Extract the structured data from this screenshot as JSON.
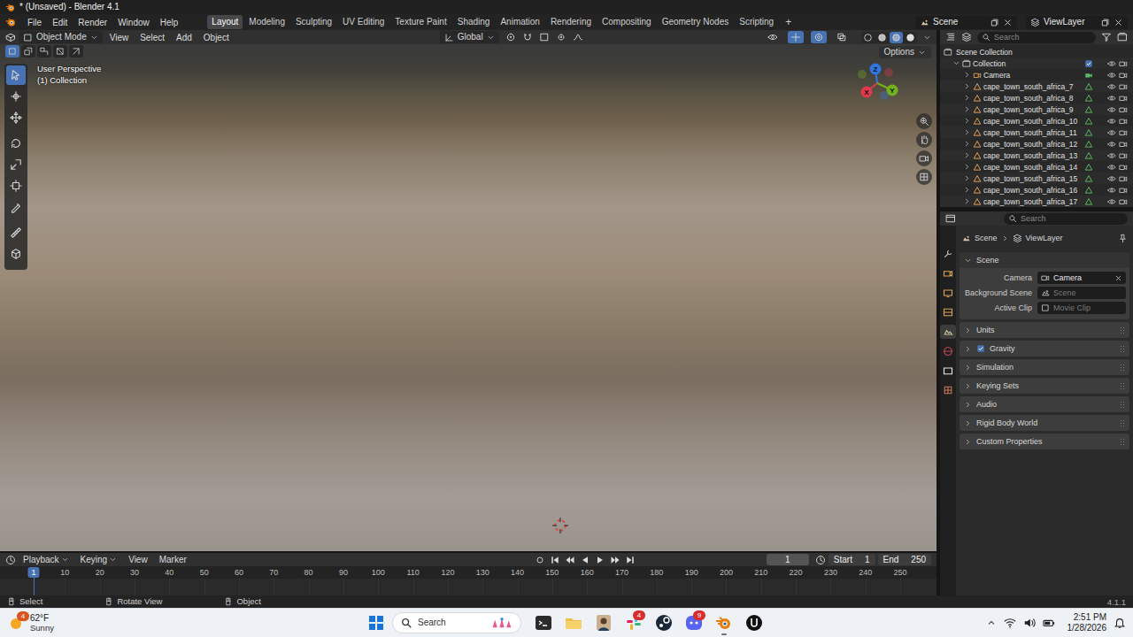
{
  "window": {
    "title": "* (Unsaved) - Blender 4.1"
  },
  "menubar": {
    "menus": [
      "File",
      "Edit",
      "Render",
      "Window",
      "Help"
    ],
    "workspaces": [
      {
        "label": "Layout",
        "selected": true
      },
      {
        "label": "Modeling",
        "selected": false
      },
      {
        "label": "Sculpting",
        "selected": false
      },
      {
        "label": "UV Editing",
        "selected": false
      },
      {
        "label": "Texture Paint",
        "selected": false
      },
      {
        "label": "Shading",
        "selected": false
      },
      {
        "label": "Animation",
        "selected": false
      },
      {
        "label": "Rendering",
        "selected": false
      },
      {
        "label": "Compositing",
        "selected": false
      },
      {
        "label": "Geometry Nodes",
        "selected": false
      },
      {
        "label": "Scripting",
        "selected": false
      }
    ],
    "add_workspace": "+",
    "scene": "Scene",
    "view_layer": "ViewLayer"
  },
  "viewport": {
    "mode": "Object Mode",
    "menus": [
      "View",
      "Select",
      "Add",
      "Object"
    ],
    "orientation": "Global",
    "options": "Options",
    "view_name": "User Perspective",
    "collection": "(1) Collection",
    "select_modes": [
      {
        "selected": true
      },
      {
        "selected": false
      },
      {
        "selected": false
      },
      {
        "selected": false
      },
      {
        "selected": false
      }
    ],
    "tools": [
      {
        "selected": true
      },
      {
        "selected": false
      },
      {
        "selected": false
      },
      {
        "selected": false
      },
      {
        "selected": false
      },
      {
        "selected": false
      },
      {
        "selected": false
      },
      {
        "selected": false
      },
      {
        "selected": false
      }
    ],
    "header_toggles": [
      {
        "selected": false
      },
      {
        "selected": true
      },
      {
        "selected": true
      },
      {
        "selected": false
      }
    ],
    "shading": [
      {
        "selected": false
      },
      {
        "selected": false
      },
      {
        "selected": true
      },
      {
        "selected": false
      }
    ],
    "gizmo": [
      {
        "label": "Z",
        "color": "#2f76e0"
      },
      {
        "label": "X",
        "color": "#e2384d"
      },
      {
        "label": "Y",
        "color": "#72b01e"
      }
    ]
  },
  "outliner": {
    "search": "Search",
    "root": "Scene Collection",
    "items": [
      {
        "label": "Collection",
        "kind": "collection",
        "checked": true,
        "visible": true
      },
      {
        "label": "Camera",
        "kind": "camera",
        "visible": true
      },
      {
        "label": "cape_town_south_africa_7",
        "kind": "mesh",
        "visible": true
      },
      {
        "label": "cape_town_south_africa_8",
        "kind": "mesh",
        "visible": true
      },
      {
        "label": "cape_town_south_africa_9",
        "kind": "mesh",
        "visible": true
      },
      {
        "label": "cape_town_south_africa_10",
        "kind": "mesh",
        "visible": true
      },
      {
        "label": "cape_town_south_africa_11",
        "kind": "mesh",
        "visible": true
      },
      {
        "label": "cape_town_south_africa_12",
        "kind": "mesh",
        "visible": true
      },
      {
        "label": "cape_town_south_africa_13",
        "kind": "mesh",
        "visible": true
      },
      {
        "label": "cape_town_south_africa_14",
        "kind": "mesh",
        "visible": true
      },
      {
        "label": "cape_town_south_africa_15",
        "kind": "mesh",
        "visible": true
      },
      {
        "label": "cape_town_south_africa_16",
        "kind": "mesh",
        "visible": true
      },
      {
        "label": "cape_town_south_africa_17",
        "kind": "mesh",
        "visible": true
      }
    ]
  },
  "properties": {
    "search": "Search",
    "tabs": [
      {
        "selected": false
      },
      {
        "selected": false
      },
      {
        "selected": false
      },
      {
        "selected": false
      },
      {
        "selected": true
      },
      {
        "selected": false
      },
      {
        "selected": false
      },
      {
        "selected": false
      }
    ],
    "breadcrumb": [
      "Scene",
      "ViewLayer"
    ],
    "panel": {
      "title": "Scene",
      "expanded": true,
      "fields": [
        {
          "label": "Camera",
          "value": "Camera",
          "placeholder": false
        },
        {
          "label": "Background Scene",
          "value": "Scene",
          "placeholder": true
        },
        {
          "label": "Active Clip",
          "value": "Movie Clip",
          "placeholder": true
        }
      ]
    },
    "sections": [
      {
        "label": "Units",
        "kind": "plain",
        "expanded": false
      },
      {
        "label": "Gravity",
        "kind": "checkbox",
        "expanded": false,
        "checked": true
      },
      {
        "label": "Simulation",
        "kind": "plain",
        "expanded": false
      },
      {
        "label": "Keying Sets",
        "kind": "plain",
        "expanded": false
      },
      {
        "label": "Audio",
        "kind": "plain",
        "expanded": false
      },
      {
        "label": "Rigid Body World",
        "kind": "plain",
        "expanded": false
      },
      {
        "label": "Custom Properties",
        "kind": "plain",
        "expanded": false
      }
    ]
  },
  "timeline": {
    "menus": [
      {
        "label": "Playback",
        "dropdown": true
      },
      {
        "label": "Keying",
        "dropdown": true
      },
      {
        "label": "View",
        "dropdown": false
      },
      {
        "label": "Marker",
        "dropdown": false
      }
    ],
    "current_frame": "1",
    "start_label": "Start",
    "start": "1",
    "end_label": "End",
    "end": "250",
    "playhead": "1",
    "ruler": [
      "10",
      "20",
      "30",
      "40",
      "50",
      "60",
      "70",
      "80",
      "90",
      "100",
      "110",
      "120",
      "130",
      "140",
      "150",
      "160",
      "170",
      "180",
      "190",
      "200",
      "210",
      "220",
      "230",
      "240",
      "250"
    ]
  },
  "status_bar": {
    "hints": [
      "Select",
      "Rotate View",
      "Object"
    ],
    "version": "4.1.1"
  },
  "taskbar": {
    "weather": {
      "temp": "62°F",
      "condition": "Sunny",
      "badge": "4"
    },
    "search": "Search",
    "apps": [
      {
        "kind": "terminal",
        "active": false
      },
      {
        "kind": "folder",
        "active": false
      },
      {
        "kind": "avatar",
        "active": false
      },
      {
        "kind": "slack",
        "active": false,
        "badge": "4"
      },
      {
        "kind": "steam",
        "active": false
      },
      {
        "kind": "discord",
        "active": false,
        "badge": "9"
      },
      {
        "kind": "blender",
        "active": true
      },
      {
        "kind": "unreal",
        "active": false
      }
    ],
    "time": "2:51 PM",
    "date": "1/28/2026"
  }
}
